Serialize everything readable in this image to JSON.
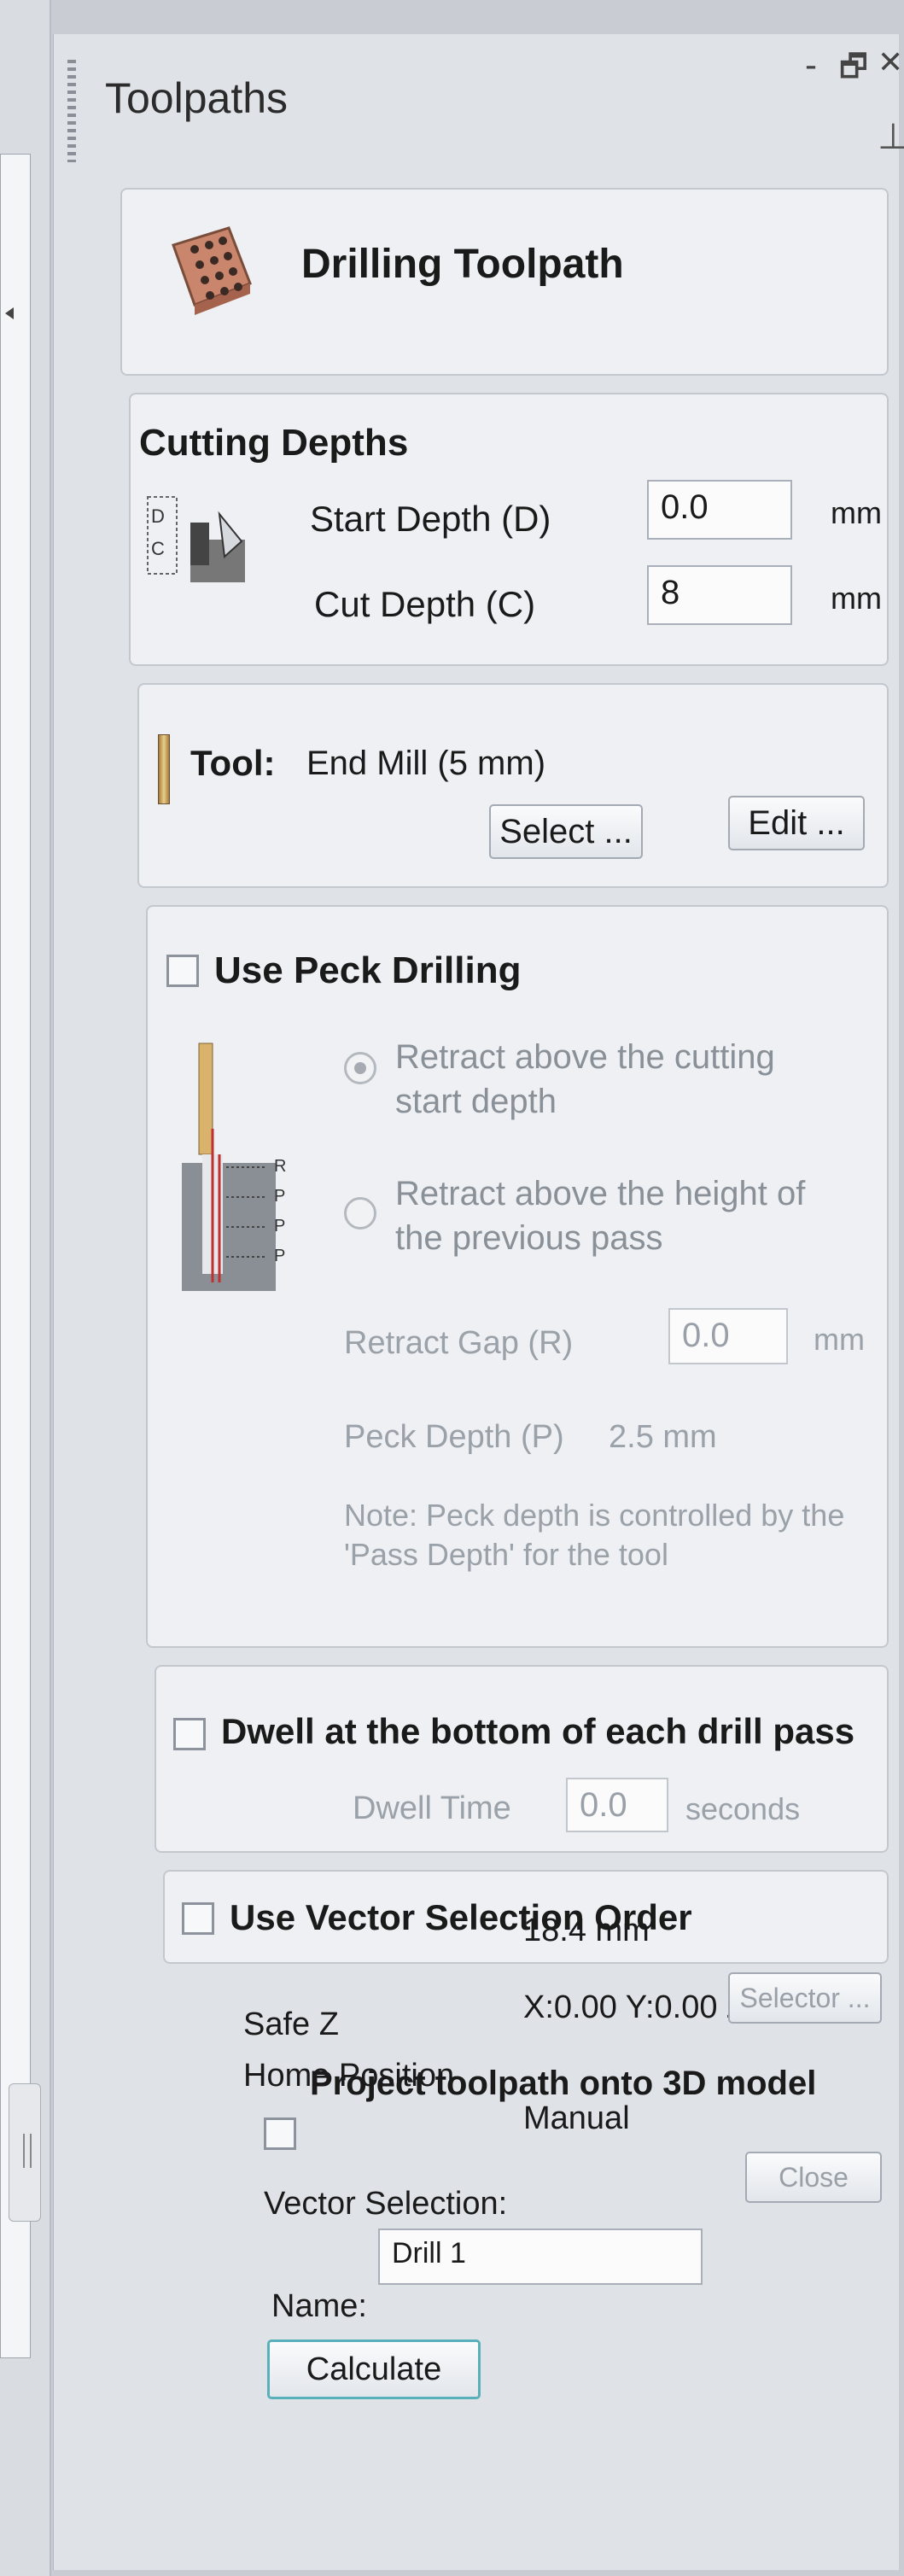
{
  "window": {
    "title": "Toolpaths",
    "minimize_glyph": "-",
    "restore_glyph": "🗗",
    "close_glyph": "✕",
    "pin_glyph": "⊥"
  },
  "drilling": {
    "title": "Drilling Toolpath",
    "icon": "drill-block-icon"
  },
  "cutting_depths": {
    "heading": "Cutting Depths",
    "start_label": "Start Depth (D)",
    "start_value": "0.0",
    "start_unit": "mm",
    "cut_label": "Cut Depth (C)",
    "cut_value": "8",
    "cut_unit": "mm",
    "icon_letters": [
      "D",
      "C"
    ]
  },
  "tool": {
    "label": "Tool:",
    "name": "End Mill (5 mm)",
    "select_btn": "Select ...",
    "edit_btn": "Edit ..."
  },
  "peck": {
    "heading": "Use Peck Drilling",
    "checked": false,
    "option1": "Retract above the cutting start depth",
    "option2": "Retract above the height of the previous pass",
    "gap_label": "Retract Gap (R)",
    "gap_value": "0.0",
    "gap_unit": "mm",
    "depth_label": "Peck Depth (P)",
    "depth_value": "2.5 mm",
    "note": "Note: Peck depth is controlled by the 'Pass Depth' for the tool",
    "icon_letters": [
      "R",
      "P",
      "P",
      "P"
    ]
  },
  "dwell": {
    "heading": "Dwell at the bottom of each drill pass",
    "checked": false,
    "time_label": "Dwell Time",
    "time_value": "0.0",
    "time_unit": "seconds"
  },
  "vector_order": {
    "heading": "Use Vector Selection Order",
    "checked": false
  },
  "misc": {
    "safe_z_label": "Safe Z",
    "safe_z_value": "18.4 mm",
    "home_label": "Home Position",
    "home_value": "X:0.00 Y:0.00 Z:23.60",
    "project_label": "Project toolpath onto 3D model",
    "project_checked": false,
    "vector_sel_label": "Vector Selection:",
    "vector_sel_value": "Manual",
    "selector_btn": "Selector ...",
    "name_label": "Name:",
    "name_value": "Drill 1",
    "calculate_btn": "Calculate",
    "close_btn": "Close"
  }
}
